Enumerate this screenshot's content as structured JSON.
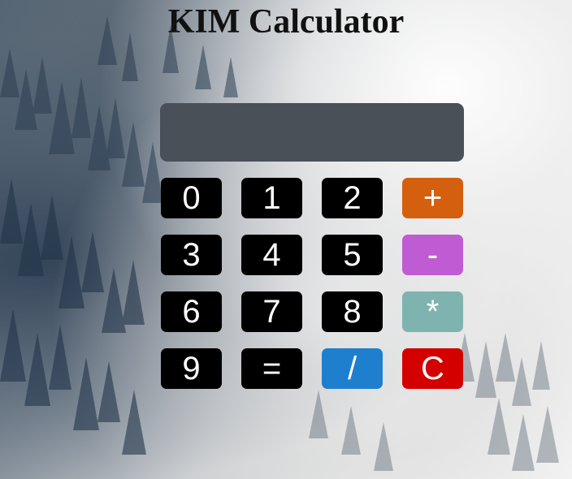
{
  "app": {
    "title": "KIM Calculator"
  },
  "display": {
    "value": ""
  },
  "keys": {
    "k0": "0",
    "k1": "1",
    "k2": "2",
    "k3": "3",
    "k4": "4",
    "k5": "5",
    "k6": "6",
    "k7": "7",
    "k8": "8",
    "k9": "9",
    "plus": "+",
    "minus": "-",
    "multiply": "*",
    "divide": "/",
    "equals": "=",
    "clear": "C"
  },
  "colors": {
    "digit_bg": "#000000",
    "plus_bg": "#d45f0f",
    "minus_bg": "#bf5bd3",
    "multiply_bg": "#7fb3b0",
    "divide_bg": "#1f7fcf",
    "clear_bg": "#d40000",
    "display_bg": "#4a5058"
  }
}
